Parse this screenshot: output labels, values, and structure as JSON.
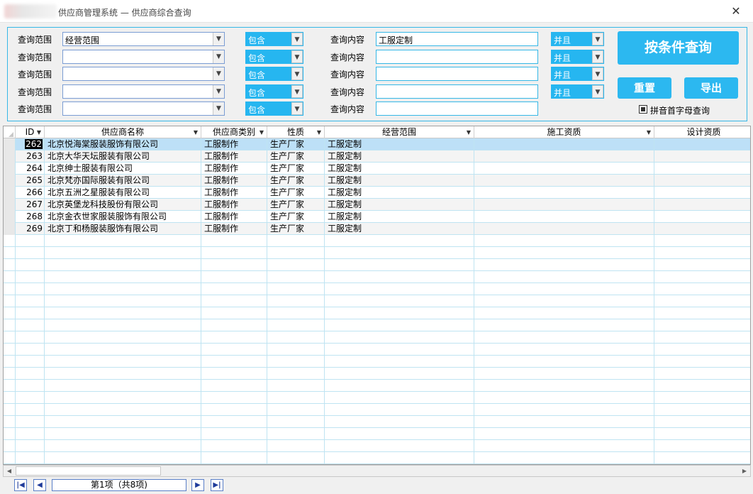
{
  "window": {
    "title": "供应商管理系统 — 供应商综合查询",
    "close_glyph": "✕"
  },
  "query": {
    "rows": [
      {
        "range_label": "查询范围",
        "field": "经营范围",
        "op": "包含",
        "content_label": "查询内容",
        "content": "工服定制",
        "logic": "并且"
      },
      {
        "range_label": "查询范围",
        "field": "",
        "op": "包含",
        "content_label": "查询内容",
        "content": "",
        "logic": "并且"
      },
      {
        "range_label": "查询范围",
        "field": "",
        "op": "包含",
        "content_label": "查询内容",
        "content": "",
        "logic": "并且"
      },
      {
        "range_label": "查询范围",
        "field": "",
        "op": "包含",
        "content_label": "查询内容",
        "content": "",
        "logic": "并且"
      },
      {
        "range_label": "查询范围",
        "field": "",
        "op": "包含",
        "content_label": "查询内容",
        "content": ""
      }
    ],
    "search_button": "按条件查询",
    "reset_button": "重置",
    "export_button": "导出",
    "pinyin_label": "拼音首字母查询",
    "pinyin_checked": true,
    "accent_color": "#2cb8f0"
  },
  "grid": {
    "columns": [
      {
        "label": "ID",
        "sortable": true
      },
      {
        "label": "供应商名称",
        "sortable": true
      },
      {
        "label": "供应商类别",
        "sortable": true
      },
      {
        "label": "性质",
        "sortable": true
      },
      {
        "label": "经营范围",
        "sortable": true
      },
      {
        "label": "施工资质",
        "sortable": true
      },
      {
        "label": "设计资质",
        "sortable": false
      }
    ],
    "rows": [
      {
        "id": "262",
        "name": "北京悦海棠服装服饰有限公司",
        "category": "工服制作",
        "nature": "生产厂家",
        "scope": "工服定制",
        "construction": "",
        "design": ""
      },
      {
        "id": "263",
        "name": "北京大华天坛服装有限公司",
        "category": "工服制作",
        "nature": "生产厂家",
        "scope": "工服定制",
        "construction": "",
        "design": ""
      },
      {
        "id": "264",
        "name": "北京绅士服装有限公司",
        "category": "工服制作",
        "nature": "生产厂家",
        "scope": "工服定制",
        "construction": "",
        "design": ""
      },
      {
        "id": "265",
        "name": "北京梵亦国际服装有限公司",
        "category": "工服制作",
        "nature": "生产厂家",
        "scope": "工服定制",
        "construction": "",
        "design": ""
      },
      {
        "id": "266",
        "name": "北京五洲之星服装有限公司",
        "category": "工服制作",
        "nature": "生产厂家",
        "scope": "工服定制",
        "construction": "",
        "design": ""
      },
      {
        "id": "267",
        "name": "北京英堡龙科技股份有限公司",
        "category": "工服制作",
        "nature": "生产厂家",
        "scope": "工服定制",
        "construction": "",
        "design": ""
      },
      {
        "id": "268",
        "name": "北京金衣世家服装服饰有限公司",
        "category": "工服制作",
        "nature": "生产厂家",
        "scope": "工服定制",
        "construction": "",
        "design": ""
      },
      {
        "id": "269",
        "name": "北京丁和杨服装服饰有限公司",
        "category": "工服制作",
        "nature": "生产厂家",
        "scope": "工服定制",
        "construction": "",
        "design": ""
      }
    ],
    "selected_row": 0,
    "empty_rows": 19
  },
  "pager": {
    "first_icon": "first-page-icon",
    "prev_icon": "prev-page-icon",
    "next_icon": "next-page-icon",
    "last_icon": "last-page-icon",
    "info": "第1项（共8项)"
  }
}
